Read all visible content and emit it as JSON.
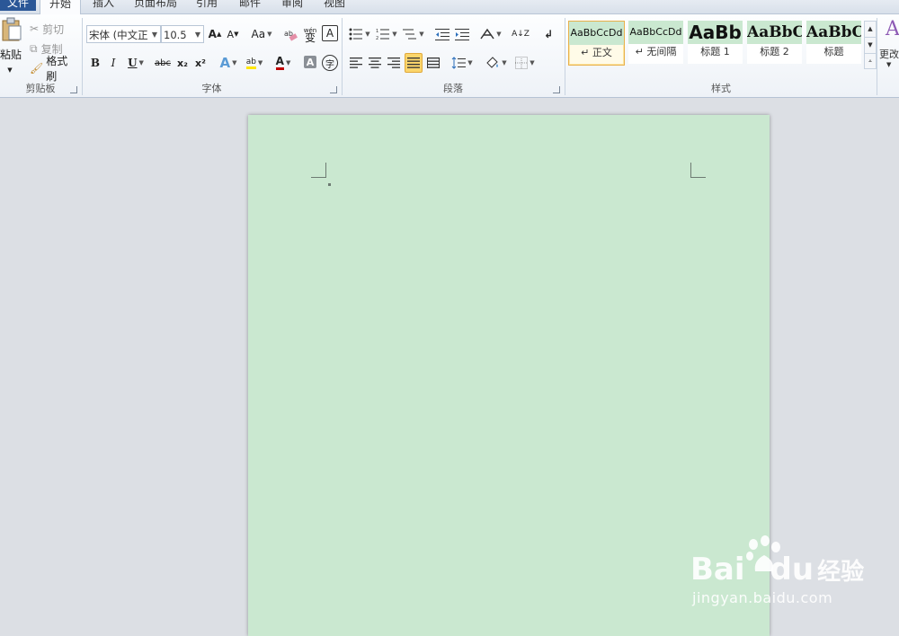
{
  "tabs": [
    {
      "label": "文件"
    },
    {
      "label": "开始"
    },
    {
      "label": "插入"
    },
    {
      "label": "页面布局"
    },
    {
      "label": "引用"
    },
    {
      "label": "邮件"
    },
    {
      "label": "审阅"
    },
    {
      "label": "视图"
    }
  ],
  "clipboard": {
    "label": "剪贴板",
    "paste": "粘贴",
    "cut": "剪切",
    "copy": "复制",
    "format_painter": "格式刷"
  },
  "font": {
    "label": "字体",
    "font_name": "宋体 (中文正",
    "font_size": "10.5",
    "grow": "A",
    "shrink": "A",
    "change_case": "Aa",
    "phonetic": "wén",
    "phonetic_char": "变",
    "border_char": "A",
    "bold": "B",
    "italic": "I",
    "underline": "U",
    "strike": "abc",
    "subscript": "x₂",
    "superscript": "x²",
    "effects": "A",
    "highlight": "ab",
    "font_color": "A",
    "shading": "A",
    "enclose": "字"
  },
  "paragraph": {
    "label": "段落",
    "sort": "A↓Z"
  },
  "styles": {
    "label": "样式",
    "tiles": [
      {
        "preview": "AaBbCcDd",
        "name": "↵ 正文"
      },
      {
        "preview": "AaBbCcDd",
        "name": "↵ 无间隔"
      },
      {
        "preview": "AaBb",
        "name": "标题 1"
      },
      {
        "preview": "AaBbC",
        "name": "标题 2"
      },
      {
        "preview": "AaBbC",
        "name": "标题"
      }
    ],
    "change_styles": "更改",
    "change_icon_letter": "A"
  },
  "watermark": {
    "brand_a": "Bai",
    "brand_b": "du",
    "brand_c": "经验",
    "url": "jingyan.baidu.com"
  },
  "colors": {
    "page_bg": "#cae8d0",
    "file_tab": "#2b5797",
    "selected_button": "#fbd56b"
  }
}
